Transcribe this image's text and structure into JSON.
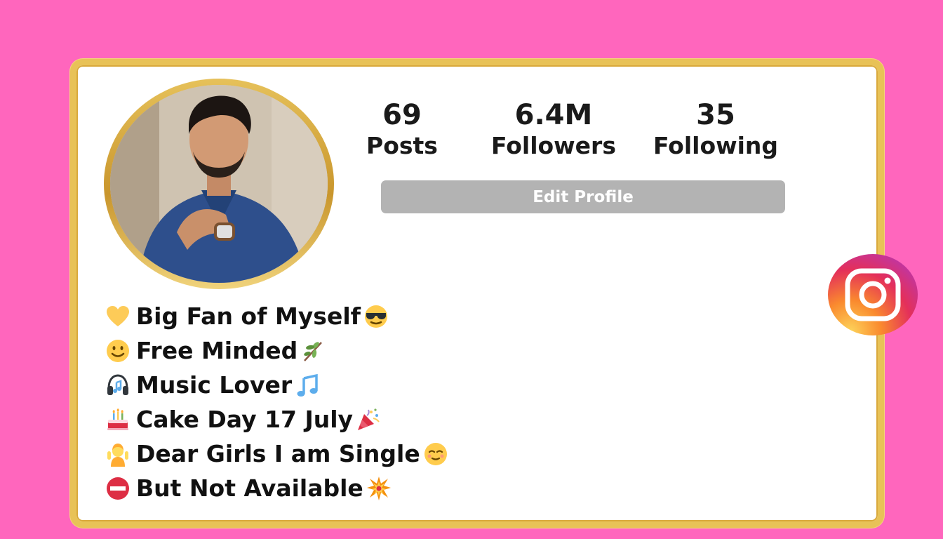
{
  "profile": {
    "stats": [
      {
        "value": "69",
        "label": "Posts"
      },
      {
        "value": "6.4M",
        "label": "Followers"
      },
      {
        "value": "35",
        "label": "Following"
      }
    ],
    "edit_button_label": "Edit Profile"
  },
  "bio": [
    {
      "lead_icon": "yellow-heart-icon",
      "text": "Big Fan of Myself",
      "trail_icon": "sunglasses-face-icon"
    },
    {
      "lead_icon": "slightly-smiling-face-icon",
      "text": "Free Minded",
      "trail_icon": "herb-icon"
    },
    {
      "lead_icon": "headphones-icon",
      "text": "Music Lover",
      "trail_icon": "musical-notes-icon"
    },
    {
      "lead_icon": "birthday-cake-icon",
      "text": "Cake Day 17 July",
      "trail_icon": "party-popper-icon"
    },
    {
      "lead_icon": "person-raising-hands-icon",
      "text": "Dear Girls I am Single",
      "trail_icon": "relieved-face-icon"
    },
    {
      "lead_icon": "no-entry-icon",
      "text": "But Not Available",
      "trail_icon": "collision-icon"
    }
  ],
  "colors": {
    "background": "#ff66bd",
    "card_border": "#e8c257",
    "button": "#b3b3b3"
  },
  "icons": {
    "brand": "instagram-icon"
  }
}
